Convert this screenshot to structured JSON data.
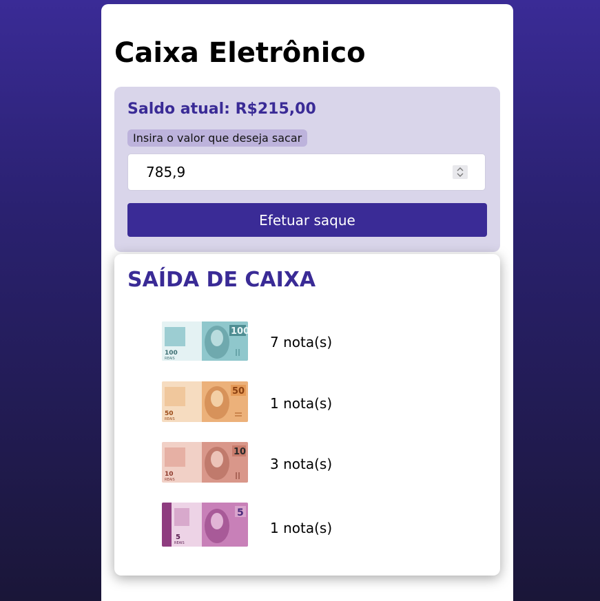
{
  "page": {
    "title": "Caixa Eletrônico"
  },
  "balance": {
    "text": "Saldo atual: R$215,00"
  },
  "withdraw_form": {
    "label": "Insira o valor que deseja sacar",
    "amount_value": "785,9",
    "button_label": "Efetuar saque"
  },
  "output": {
    "title": "SAÍDA DE CAIXA",
    "notes": [
      {
        "denomination": "100",
        "count_text": "7 nota(s)",
        "color": "#7fbcc2",
        "icon": "banknote-100-icon"
      },
      {
        "denomination": "50",
        "count_text": "1 nota(s)",
        "color": "#e7a96a",
        "icon": "banknote-50-icon"
      },
      {
        "denomination": "10",
        "count_text": "3 nota(s)",
        "color": "#d08a7d",
        "icon": "banknote-10-icon"
      },
      {
        "denomination": "5",
        "count_text": "1 nota(s)",
        "color": "#b8649f",
        "icon": "banknote-5-icon"
      }
    ]
  },
  "colors": {
    "accent": "#3a2b96",
    "panel": "#d9d5ea",
    "label_bg": "#bdb3dc"
  }
}
